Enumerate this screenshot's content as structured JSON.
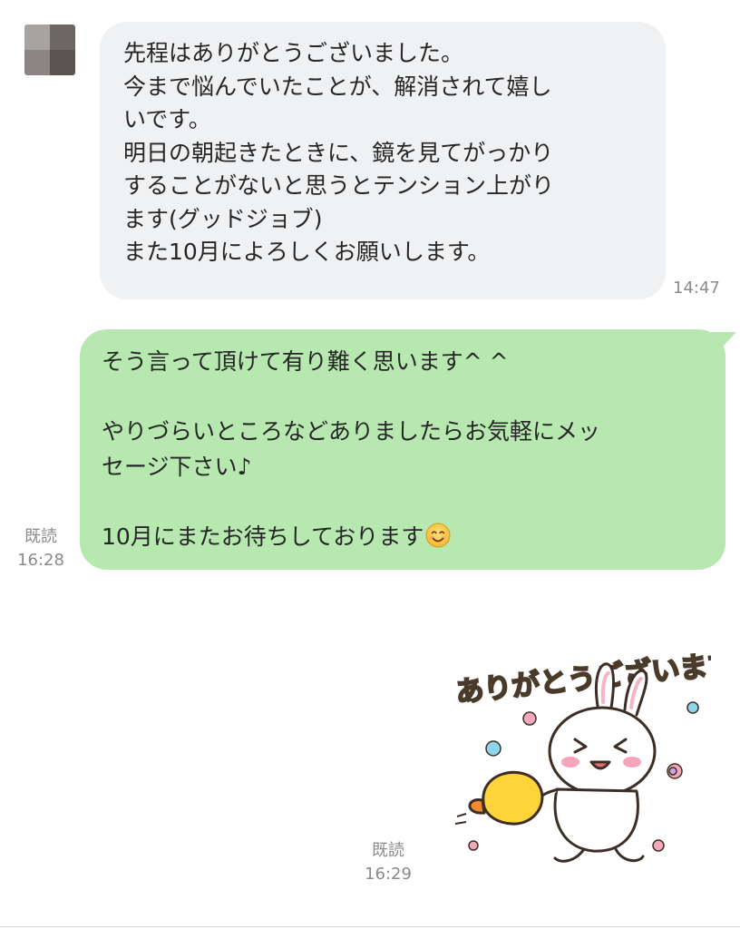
{
  "colors": {
    "incoming_bubble": "#f0f1f3",
    "outgoing_bubble": "#b6e8b0",
    "meta_text": "#8b8b8b"
  },
  "avatar": {
    "pixels": [
      "#a7a3a1",
      "#6d6764",
      "#8c8583",
      "#5a5350"
    ]
  },
  "incoming_message": {
    "lines": [
      "先程はありがとうございました。",
      "今まで悩んでいたことが、解消されて嬉し",
      "いです。",
      "明日の朝起きたときに、鏡を見てがっかり",
      "することがないと思うとテンション上がり",
      "ます(グッドジョブ)",
      "また10月によろしくお願いします。"
    ],
    "time": "14:47"
  },
  "outgoing_message": {
    "lines": [
      "そう言って頂けて有り難く思います^ ^",
      "",
      "やりづらいところなどありましたらお気軽にメッ",
      "セージ下さい♪",
      "",
      "10月にまたお待ちしております"
    ],
    "emoji": "smiling-face-icon",
    "read_label": "既読",
    "time": "16:28"
  },
  "sticker_message": {
    "sticker_text": "ありがとうございます!",
    "sticker_icon": "bunny-thank-you-sticker",
    "read_label": "既読",
    "time": "16:29"
  }
}
